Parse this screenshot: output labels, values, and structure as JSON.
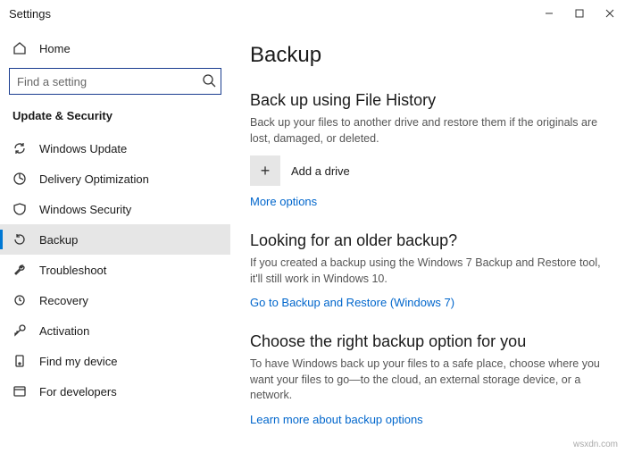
{
  "titlebar": {
    "title": "Settings"
  },
  "sidebar": {
    "home_label": "Home",
    "search_placeholder": "Find a setting",
    "section_title": "Update & Security",
    "items": [
      {
        "label": "Windows Update"
      },
      {
        "label": "Delivery Optimization"
      },
      {
        "label": "Windows Security"
      },
      {
        "label": "Backup"
      },
      {
        "label": "Troubleshoot"
      },
      {
        "label": "Recovery"
      },
      {
        "label": "Activation"
      },
      {
        "label": "Find my device"
      },
      {
        "label": "For developers"
      }
    ]
  },
  "main": {
    "title": "Backup",
    "filehistory": {
      "heading": "Back up using File History",
      "desc": "Back up your files to another drive and restore them if the originals are lost, damaged, or deleted.",
      "add_drive": "Add a drive",
      "more_options": "More options"
    },
    "older": {
      "heading": "Looking for an older backup?",
      "desc": "If you created a backup using the Windows 7 Backup and Restore tool, it'll still work in Windows 10.",
      "link": "Go to Backup and Restore (Windows 7)"
    },
    "choose": {
      "heading": "Choose the right backup option for you",
      "desc": "To have Windows back up your files to a safe place, choose where you want your files to go—to the cloud, an external storage device, or a network.",
      "link": "Learn more about backup options"
    }
  },
  "watermark": "wsxdn.com"
}
